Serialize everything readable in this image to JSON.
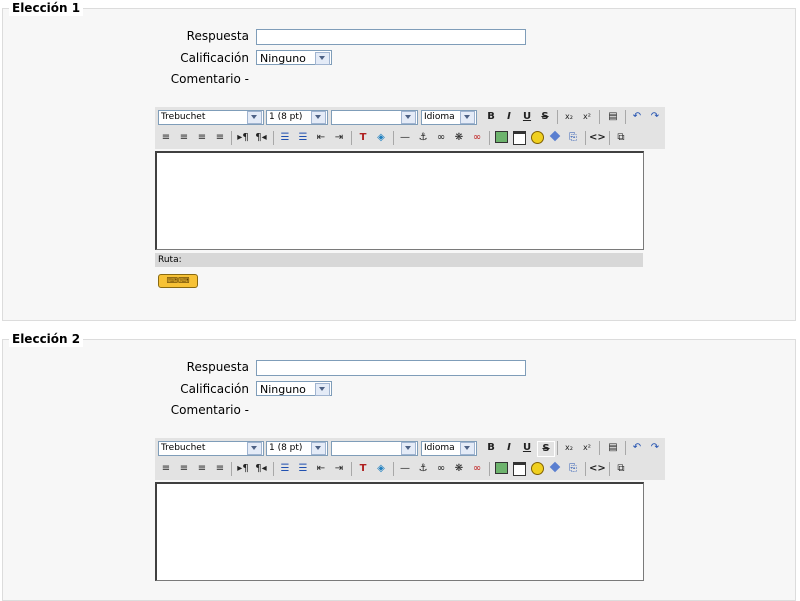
{
  "choices": [
    {
      "legend": "Elección 1",
      "labels": {
        "answer": "Respuesta",
        "grade": "Calificación",
        "comment": "Comentario -"
      },
      "answer_value": "",
      "grade_value": "Ninguno",
      "editor": {
        "font": "Trebuchet",
        "size": "1 (8 pt)",
        "style": "",
        "language": "Idioma",
        "path_label": "Ruta:"
      }
    },
    {
      "legend": "Elección 2",
      "labels": {
        "answer": "Respuesta",
        "grade": "Calificación",
        "comment": "Comentario -"
      },
      "answer_value": "",
      "grade_value": "Ninguno",
      "editor": {
        "font": "Trebuchet",
        "size": "1 (8 pt)",
        "style": "",
        "language": "Idioma"
      }
    }
  ],
  "toolbar": {
    "bold": "B",
    "italic": "I",
    "underline": "U",
    "strike": "S",
    "subscript": "x₂",
    "superscript": "x²",
    "undo": "↶",
    "redo": "↷",
    "rule": "—",
    "anchor": "⚓",
    "source": "<>"
  },
  "colors": {
    "fieldset_bg": "#f7f7f7",
    "toolbar_bg": "#e3e3e3",
    "border": "#7f9db9"
  }
}
